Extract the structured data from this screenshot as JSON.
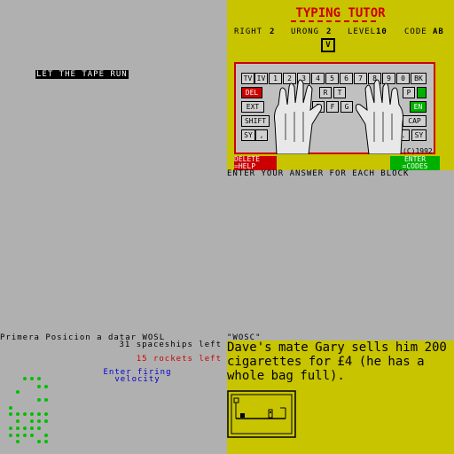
{
  "left": {
    "tape_message": "LET THE TAPE RUN"
  },
  "tutor": {
    "title": "TYPING TUTOR",
    "stats": {
      "right_label": "RIGHT",
      "right_value": "2",
      "wrong_label": "URONG",
      "wrong_value": "2",
      "level_label": "LEVEL",
      "level_value": "10",
      "code_label": "CODE",
      "code_value": "AB"
    },
    "current_key": "V",
    "keys": {
      "row1": [
        "TV",
        "IV",
        "1",
        "2",
        "3",
        "4",
        "5",
        "6",
        "7",
        "8",
        "9",
        "0",
        "BK"
      ],
      "row2_left": "DEL",
      "row2_letters": [
        "R",
        "T",
        "P"
      ],
      "row3_left": "EXT",
      "row3_letters": [
        "D",
        "F",
        "G"
      ],
      "row3_right": "EN",
      "row4_left": "SHIFT",
      "row4_right": "CAP",
      "row5_left": "SY",
      "row5_comma": ",",
      "row5_dot": ".",
      "row5_right": "SY"
    },
    "copyright": "(C)1992",
    "delete_help_line1": "DELETE",
    "delete_help_line2": "=HELP",
    "enter_codes_line1": "ENTER",
    "enter_codes_line2": "=CODES",
    "instruction": "ENTER YOUR ANSWER FOR EACH BLOCK"
  },
  "game": {
    "line1": "Primera Posicion a datar WOSL",
    "spaceships": "31 spaceships left",
    "rockets": "15 rockets left",
    "firing_line1": "Enter firing",
    "firing_line2": "velocity"
  },
  "story": {
    "label": "\"WOSC\"",
    "text": "Dave's mate Gary sells him 200 cigarettes for £4 (he has a whole bag full)."
  },
  "colors": {
    "yellow_panel": "#c8c400",
    "red": "#cc0000",
    "green": "#00b000",
    "blue": "#0000cc",
    "background": "#b0b0b0"
  }
}
